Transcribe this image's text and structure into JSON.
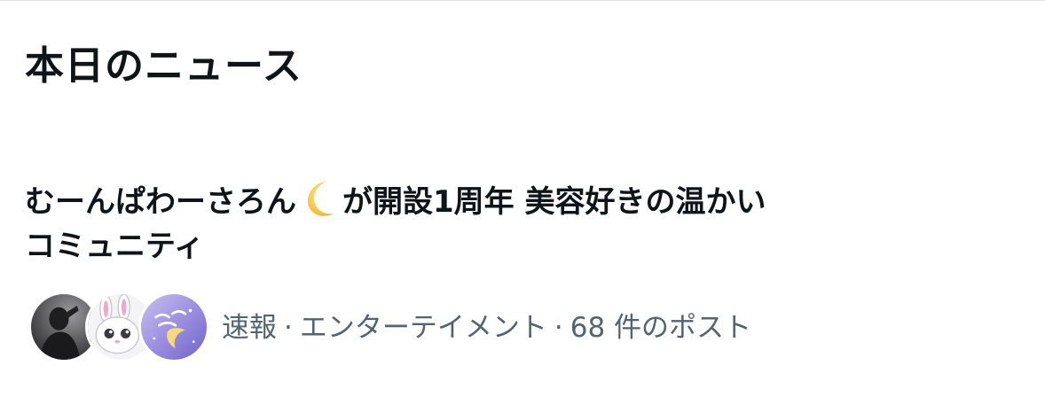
{
  "section": {
    "title": "本日のニュース"
  },
  "news": {
    "headline_part1": "むーんぱわーさろん",
    "headline_icon": "crescent-moon-emoji",
    "headline_part2": "が開設1周年 美容好きの温かい",
    "headline_line2": "コミュニティ",
    "category": "速報",
    "topic": "エンターテイメント",
    "post_count": "68 件のポスト",
    "separator": "·",
    "avatars": [
      "avatar-dark-photo",
      "avatar-bunny-character",
      "avatar-moon-power-salon-logo"
    ]
  },
  "colors": {
    "text_primary": "#0f1419",
    "text_secondary": "#536471",
    "divider": "#e1e4e7",
    "moon": "#f5c542"
  }
}
